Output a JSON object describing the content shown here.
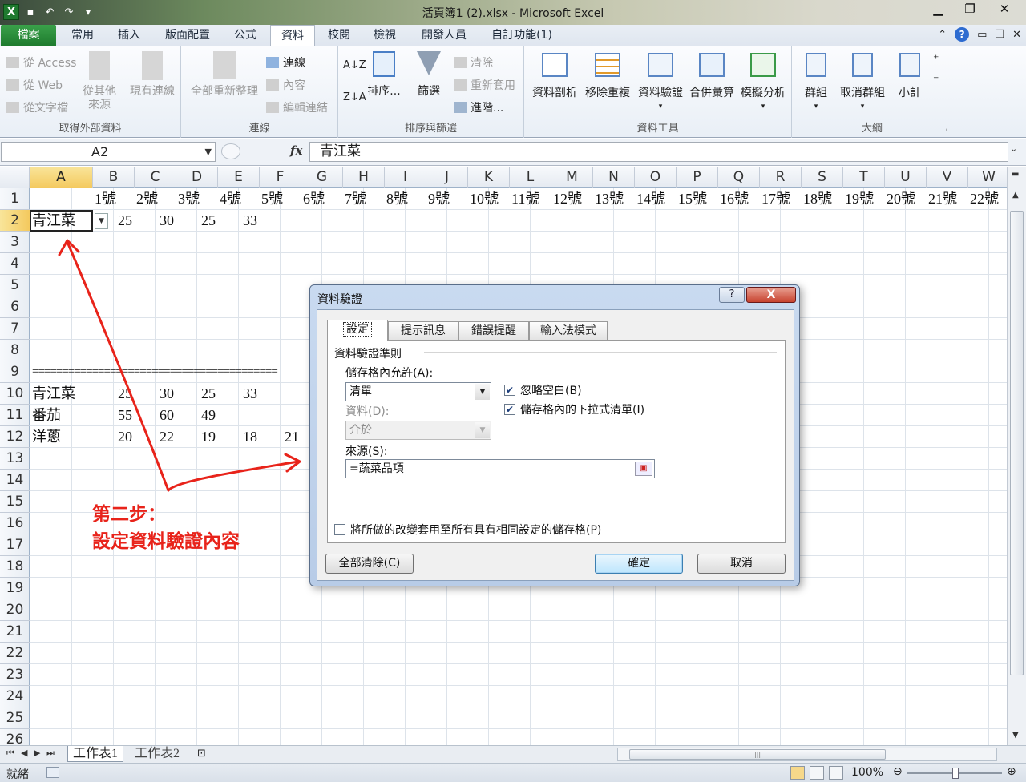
{
  "window": {
    "title": "活頁簿1 (2).xlsx - Microsoft Excel"
  },
  "ribbon_tabs": [
    {
      "label": "檔案",
      "name": "tab-file"
    },
    {
      "label": "常用",
      "name": "tab-home"
    },
    {
      "label": "插入",
      "name": "tab-insert"
    },
    {
      "label": "版面配置",
      "name": "tab-page-layout"
    },
    {
      "label": "公式",
      "name": "tab-formulas"
    },
    {
      "label": "資料",
      "name": "tab-data"
    },
    {
      "label": "校閱",
      "name": "tab-review"
    },
    {
      "label": "檢視",
      "name": "tab-view"
    },
    {
      "label": "開發人員",
      "name": "tab-developer"
    },
    {
      "label": "自訂功能(1)",
      "name": "tab-custom"
    }
  ],
  "ribbon": {
    "external": {
      "label": "取得外部資料",
      "from_access": "從 Access",
      "from_web": "從 Web",
      "from_text": "從文字檔",
      "from_other": "從其他",
      "from_other2": "來源",
      "existing": "現有連線"
    },
    "connections": {
      "label": "連線",
      "refresh_all": "全部重新整理",
      "connections": "連線",
      "properties": "內容",
      "edit_links": "編輯連結"
    },
    "sort_filter": {
      "label": "排序與篩選",
      "sort": "排序...",
      "filter": "篩選",
      "clear": "清除",
      "reapply": "重新套用",
      "advanced": "進階..."
    },
    "data_tools": {
      "label": "資料工具",
      "text_to_columns": "資料剖析",
      "remove_dup": "移除重複",
      "validation": "資料驗證",
      "consolidate": "合併彙算",
      "what_if": "模擬分析"
    },
    "outline": {
      "label": "大綱",
      "group": "群組",
      "ungroup": "取消群組",
      "subtotal": "小計"
    }
  },
  "formula_bar": {
    "name_box": "A2",
    "fx": "fx",
    "content": "青江菜"
  },
  "columns": [
    "A",
    "B",
    "C",
    "D",
    "E",
    "F",
    "G",
    "H",
    "I",
    "J",
    "K",
    "L",
    "M",
    "N",
    "O",
    "P",
    "Q",
    "R",
    "S",
    "T",
    "U",
    "V",
    "W"
  ],
  "rows": [
    "1",
    "2",
    "3",
    "4",
    "5",
    "6",
    "7",
    "8",
    "9",
    "10",
    "11",
    "12",
    "13",
    "14",
    "15",
    "16",
    "17",
    "18",
    "19",
    "20",
    "21",
    "22",
    "23",
    "24",
    "25",
    "26"
  ],
  "row1_headers": [
    "1號",
    "2號",
    "3號",
    "4號",
    "5號",
    "6號",
    "7號",
    "8號",
    "9號",
    "10號",
    "11號",
    "12號",
    "13號",
    "14號",
    "15號",
    "16號",
    "17號",
    "18號",
    "19號",
    "20號",
    "21號",
    "22號"
  ],
  "row2": {
    "a": "青江菜",
    "values": [
      "25",
      "30",
      "25",
      "33"
    ]
  },
  "separator": "=========================================",
  "table": [
    {
      "name": "青江菜",
      "values": [
        "25",
        "30",
        "25",
        "33"
      ]
    },
    {
      "name": "番茄",
      "values": [
        "55",
        "60",
        "49"
      ]
    },
    {
      "name": "洋蔥",
      "values": [
        "20",
        "22",
        "19",
        "18",
        "21"
      ]
    }
  ],
  "sheets": [
    "工作表1",
    "工作表2"
  ],
  "status": {
    "ready": "就緒",
    "zoom": "100%"
  },
  "dialog": {
    "title": "資料驗證",
    "help": "?",
    "close": "X",
    "tabs": [
      "設定",
      "提示訊息",
      "錯誤提醒",
      "輸入法模式"
    ],
    "section": "資料驗證準則",
    "allow_label": "儲存格內允許(A):",
    "allow_value": "清單",
    "data_label": "資料(D):",
    "data_value": "介於",
    "ignore_blank": "忽略空白(B)",
    "in_cell_dropdown": "儲存格內的下拉式清單(I)",
    "source_label": "來源(S):",
    "source_value": "=蔬菜品項",
    "apply_all": "將所做的改變套用至所有具有相同設定的儲存格(P)",
    "clear_all": "全部清除(C)",
    "ok": "確定",
    "cancel": "取消"
  },
  "annotation": {
    "line1": "第二步：",
    "line2": "設定資料驗證內容",
    "color": "#e8231a"
  }
}
